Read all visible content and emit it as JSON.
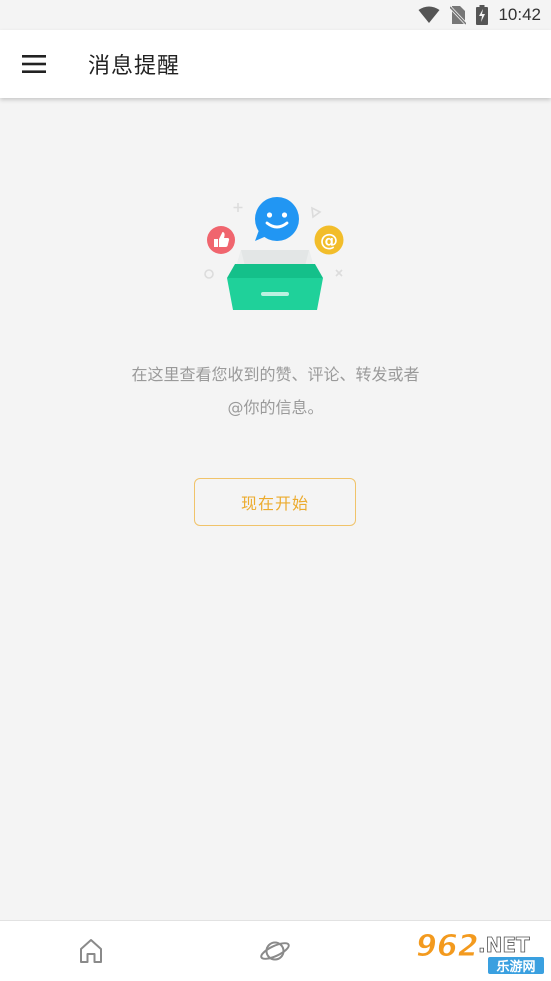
{
  "status_bar": {
    "time": "10:42"
  },
  "app_bar": {
    "title": "消息提醒"
  },
  "empty_state": {
    "line1": "在这里查看您收到的赞、评论、转发或者",
    "line2": "@你的信息。",
    "button_label": "现在开始"
  },
  "bottom_nav": {
    "items": [
      {
        "icon": "home-icon"
      },
      {
        "icon": "planet-icon"
      }
    ]
  },
  "watermark": {
    "number": "962",
    "suffix": ".NET",
    "name": "乐游网"
  },
  "colors": {
    "accent": "#ecab2e",
    "box_green": "#1fd19a",
    "bubble_blue": "#2196f3",
    "like_red": "#f0656e",
    "at_yellow": "#f2bd2a",
    "background": "#f4f4f4"
  }
}
